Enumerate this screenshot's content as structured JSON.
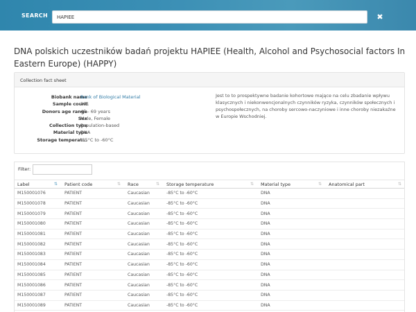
{
  "search": {
    "label": "SEARCH",
    "value": "HAPIEE",
    "close_icon": "close-icon"
  },
  "page_title": "DNA polskich uczestników badań projektu HAPIEE (Health, Alcohol and Psychosocial factors In Eastern Europe) (HAPPY)",
  "factsheet": {
    "header": "Collection fact sheet",
    "facts": [
      {
        "key": "Biobank name",
        "value": "Bank of Biological Material",
        "link": true
      },
      {
        "key": "Sample count",
        "value": "201",
        "link": false
      },
      {
        "key": "Donors age range",
        "value": "45 - 69 years",
        "link": false
      },
      {
        "key": "Sex",
        "value": "Male, Female",
        "link": false
      },
      {
        "key": "Collection type",
        "value": "Population-based",
        "link": false
      },
      {
        "key": "Material type",
        "value": "DNA",
        "link": false
      },
      {
        "key": "Storage temperat...",
        "value": "-85°C to -60°C",
        "link": false
      }
    ],
    "description": "Jest to to prospektywne badanie kohortowe mające na celu zbadanie wpływu klasycznych i niekonwencjonalnych czynników ryzyka, czynników społecznych i psychospołecznych, na choroby sercowo-naczyniowe i inne choroby niezakaźne w Europie Wschodniej."
  },
  "table": {
    "filter_label": "Filter:",
    "filter_value": "",
    "sort_icon": "sort-icon",
    "columns": [
      "Label",
      "Patient code",
      "Race",
      "Storage temperature",
      "Material type",
      "Anatomical part"
    ],
    "rows": [
      [
        "M150001076",
        "PATIENT",
        "Caucasian",
        "-85°C to -60°C",
        "DNA",
        ""
      ],
      [
        "M150001078",
        "PATIENT",
        "Caucasian",
        "-85°C to -60°C",
        "DNA",
        ""
      ],
      [
        "M150001079",
        "PATIENT",
        "Caucasian",
        "-85°C to -60°C",
        "DNA",
        ""
      ],
      [
        "M150001080",
        "PATIENT",
        "Caucasian",
        "-85°C to -60°C",
        "DNA",
        ""
      ],
      [
        "M150001081",
        "PATIENT",
        "Caucasian",
        "-85°C to -60°C",
        "DNA",
        ""
      ],
      [
        "M150001082",
        "PATIENT",
        "Caucasian",
        "-85°C to -60°C",
        "DNA",
        ""
      ],
      [
        "M150001083",
        "PATIENT",
        "Caucasian",
        "-85°C to -60°C",
        "DNA",
        ""
      ],
      [
        "M150001084",
        "PATIENT",
        "Caucasian",
        "-85°C to -60°C",
        "DNA",
        ""
      ],
      [
        "M150001085",
        "PATIENT",
        "Caucasian",
        "-85°C to -60°C",
        "DNA",
        ""
      ],
      [
        "M150001086",
        "PATIENT",
        "Caucasian",
        "-85°C to -60°C",
        "DNA",
        ""
      ],
      [
        "M150001087",
        "PATIENT",
        "Caucasian",
        "-85°C to -60°C",
        "DNA",
        ""
      ],
      [
        "M150001089",
        "PATIENT",
        "Caucasian",
        "-85°C to -60°C",
        "DNA",
        ""
      ]
    ]
  },
  "colors": {
    "header_bar": "#3b8fb5",
    "link": "#2f7aa5"
  }
}
